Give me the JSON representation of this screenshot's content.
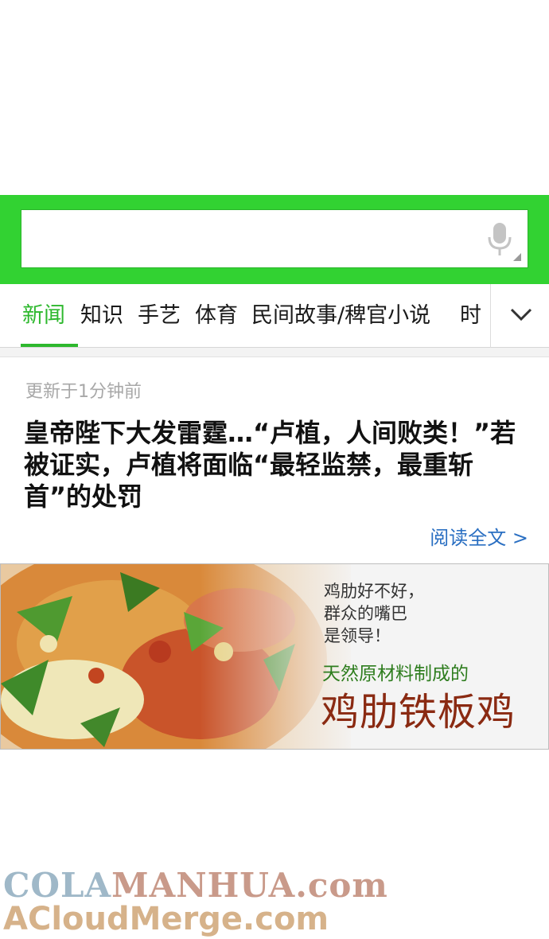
{
  "search": {
    "value": "",
    "placeholder": ""
  },
  "tabs": {
    "items": [
      {
        "label": "新闻"
      },
      {
        "label": "知识"
      },
      {
        "label": "手艺"
      },
      {
        "label": "体育"
      },
      {
        "label": "民间故事/稗官小说"
      },
      {
        "label": "时"
      }
    ],
    "active_index": 0
  },
  "news": {
    "update_time": "更新于1分钟前",
    "headline": "皇帝陛下大发雷霆…“卢植，人间败类！”若被证实，卢植将面临“最轻监禁，最重斩首”的处罚",
    "read_more": "阅读全文 >"
  },
  "ad": {
    "line1": "鸡肋好不好，",
    "line2": "群众的嘴巴",
    "line3": "是领导！",
    "subtitle": "天然原材料制成的",
    "title": "鸡肋铁板鸡"
  },
  "watermark": {
    "line1_part1": "COLA",
    "line1_part2": "MANHUA",
    "line1_part3": ".com",
    "line2": "ACloudMerge.com"
  },
  "colors": {
    "accent_green": "#2db82d",
    "search_band": "#32d232",
    "link_blue": "#2a6fc2"
  },
  "icons": [
    "microphone-icon",
    "chevron-down-icon"
  ]
}
